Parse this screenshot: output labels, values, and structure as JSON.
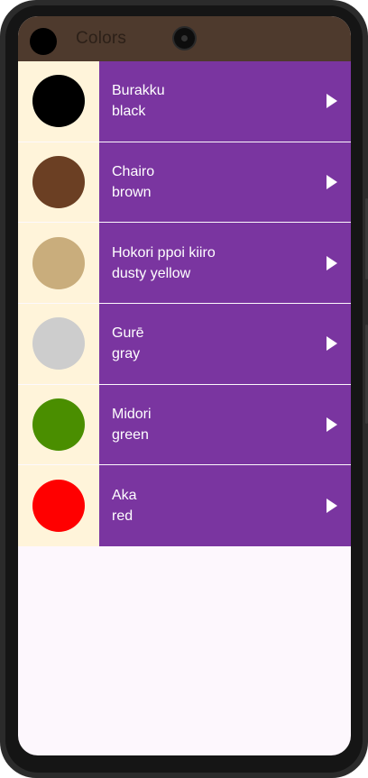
{
  "app": {
    "title": "Colors"
  },
  "colors": [
    {
      "romaji": "Burakku",
      "english": "black",
      "swatch": "#000000"
    },
    {
      "romaji": "Chairo",
      "english": "brown",
      "swatch": "#6b3f23"
    },
    {
      "romaji": "Hokori ppoi kiiro",
      "english": "dusty yellow",
      "swatch": "#c9ad7c"
    },
    {
      "romaji": "Gurē",
      "english": "gray",
      "swatch": "#cdcdcd"
    },
    {
      "romaji": "Midori",
      "english": "green",
      "swatch": "#4a8e00"
    },
    {
      "romaji": "Aka",
      "english": "red",
      "swatch": "#ff0000"
    }
  ],
  "theme": {
    "appbar": "#4e3a2d",
    "row_background": "#7a35a0",
    "swatch_background": "#fff4da",
    "screen_background": "#fdf7fd"
  },
  "icons": {
    "logo": "app-logo-icon",
    "play": "play-icon"
  }
}
